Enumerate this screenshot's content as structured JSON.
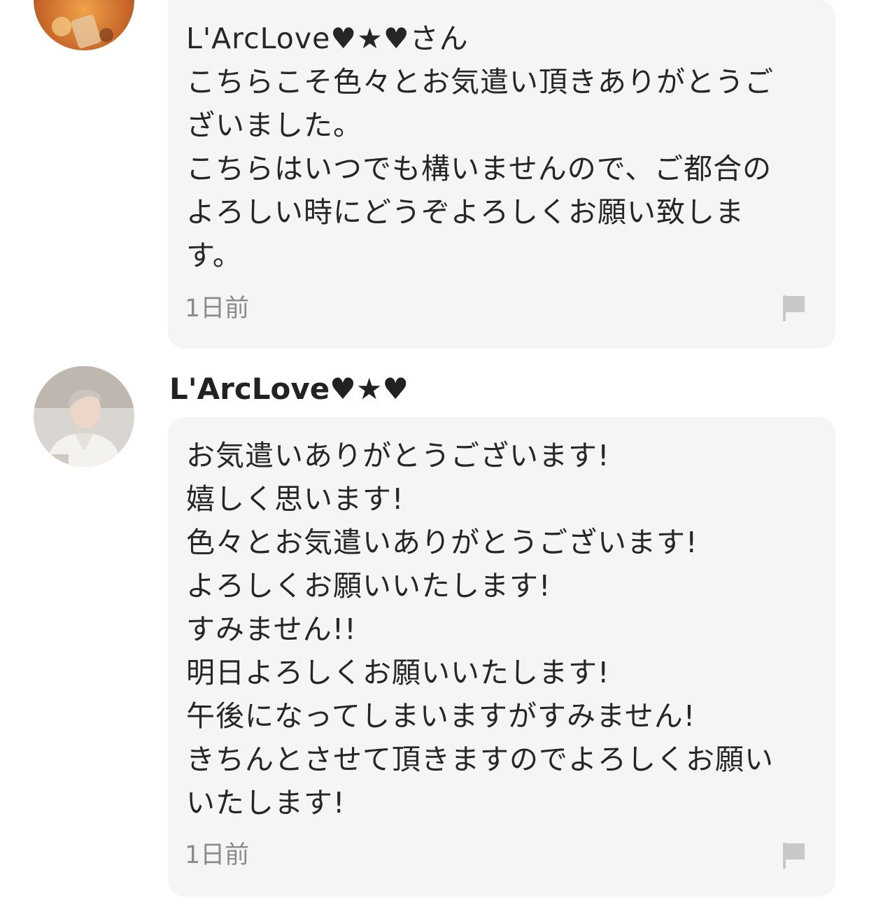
{
  "comments": [
    {
      "author": "",
      "lines": [
        "L'ArcLove♥★♥さん",
        "こちらこそ色々とお気遣い頂きありがとうご",
        "ざいました。",
        "こちらはいつでも構いませんので、ご都合の",
        "よろしい時にどうぞよろしくお願い致しま",
        "す。"
      ],
      "timestamp": "1日前",
      "report_icon": "flag-icon"
    },
    {
      "author": "L'ArcLove♥★♥",
      "lines": [
        "お気遣いありがとうございます!",
        "嬉しく思います!",
        "色々とお気遣いありがとうございます!",
        "よろしくお願いいたします!",
        "すみません!!",
        "明日よろしくお願いいたします!",
        "午後になってしまいますがすみません!",
        "きちんとさせて頂きますのでよろしくお願い",
        "いたします!"
      ],
      "timestamp": "1日前",
      "report_icon": "flag-icon"
    }
  ],
  "colors": {
    "bubble_bg": "#f5f5f6",
    "text": "#262626",
    "timestamp": "#8b8b8b",
    "flag": "#c8c8c8"
  }
}
